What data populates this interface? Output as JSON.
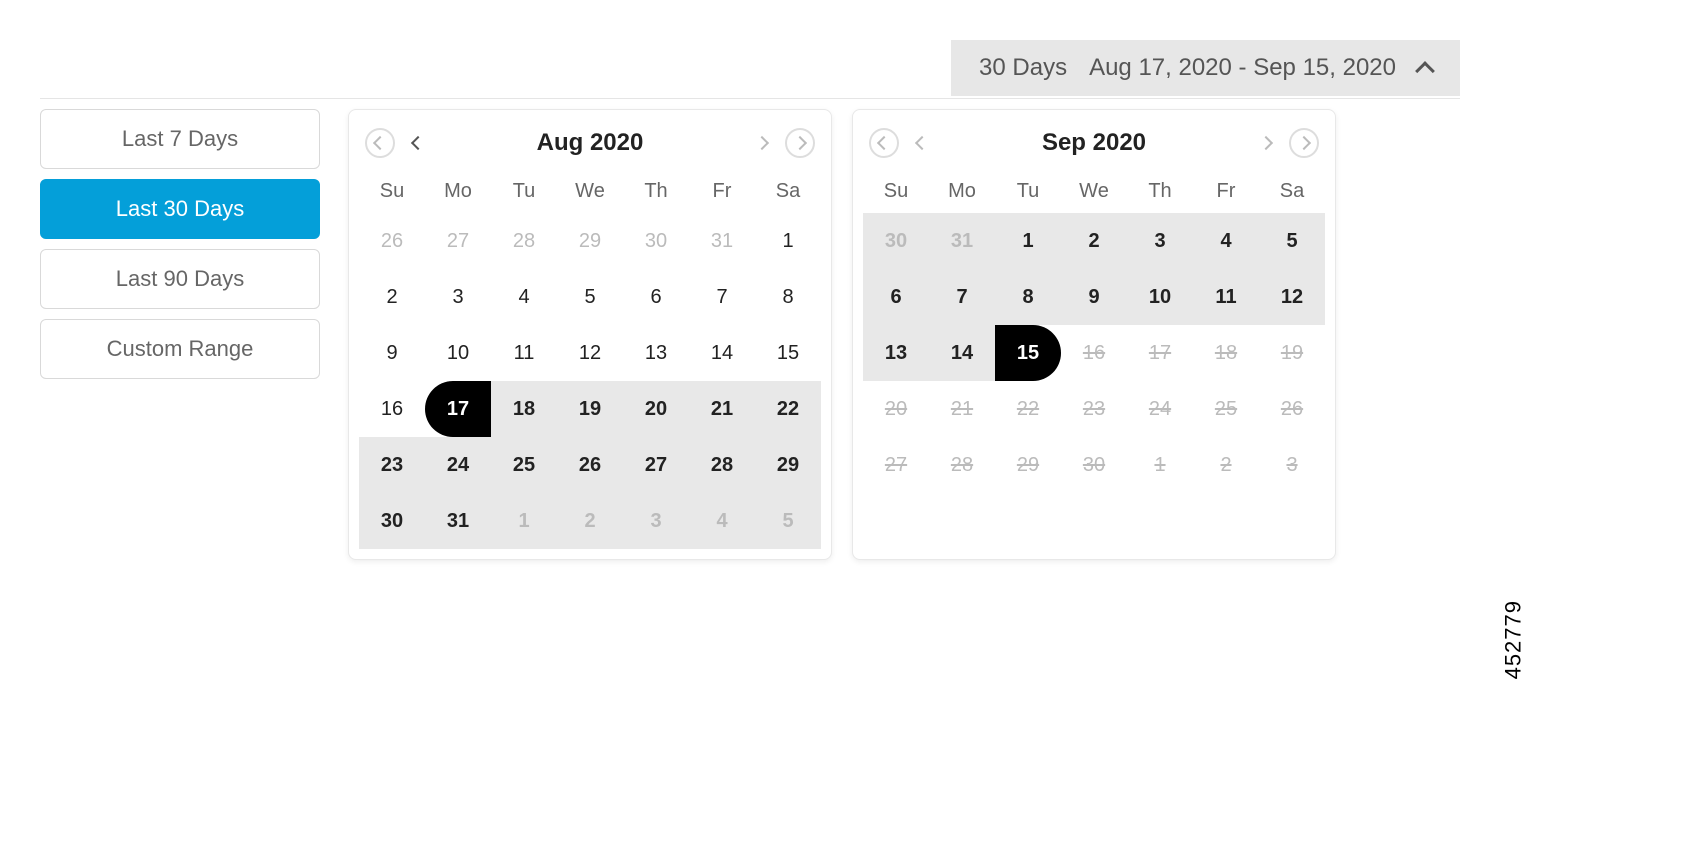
{
  "topbar": {
    "duration": "30 Days",
    "range_text": "Aug 17, 2020 - Sep 15, 2020"
  },
  "presets": [
    {
      "key": "last7",
      "label": "Last 7 Days",
      "active": false
    },
    {
      "key": "last30",
      "label": "Last 30 Days",
      "active": true
    },
    {
      "key": "last90",
      "label": "Last 90 Days",
      "active": false
    },
    {
      "key": "custom",
      "label": "Custom Range",
      "active": false
    }
  ],
  "dow": [
    "Su",
    "Mo",
    "Tu",
    "We",
    "Th",
    "Fr",
    "Sa"
  ],
  "calendars": [
    {
      "title": "Aug 2020",
      "nav_prev_enabled": true,
      "nav_next_enabled": false,
      "weeks": [
        [
          {
            "n": 26,
            "off": true
          },
          {
            "n": 27,
            "off": true
          },
          {
            "n": 28,
            "off": true
          },
          {
            "n": 29,
            "off": true
          },
          {
            "n": 30,
            "off": true
          },
          {
            "n": 31,
            "off": true
          },
          {
            "n": 1
          }
        ],
        [
          {
            "n": 2
          },
          {
            "n": 3
          },
          {
            "n": 4
          },
          {
            "n": 5
          },
          {
            "n": 6
          },
          {
            "n": 7
          },
          {
            "n": 8
          }
        ],
        [
          {
            "n": 9
          },
          {
            "n": 10
          },
          {
            "n": 11
          },
          {
            "n": 12
          },
          {
            "n": 13
          },
          {
            "n": 14
          },
          {
            "n": 15
          }
        ],
        [
          {
            "n": 16
          },
          {
            "n": 17,
            "start": true
          },
          {
            "n": 18,
            "in": true
          },
          {
            "n": 19,
            "in": true
          },
          {
            "n": 20,
            "in": true
          },
          {
            "n": 21,
            "in": true
          },
          {
            "n": 22,
            "in": true
          }
        ],
        [
          {
            "n": 23,
            "in": true
          },
          {
            "n": 24,
            "in": true
          },
          {
            "n": 25,
            "in": true
          },
          {
            "n": 26,
            "in": true
          },
          {
            "n": 27,
            "in": true
          },
          {
            "n": 28,
            "in": true
          },
          {
            "n": 29,
            "in": true
          }
        ],
        [
          {
            "n": 30,
            "in": true
          },
          {
            "n": 31,
            "in": true
          },
          {
            "n": 1,
            "off": true,
            "in": true
          },
          {
            "n": 2,
            "off": true,
            "in": true
          },
          {
            "n": 3,
            "off": true,
            "in": true
          },
          {
            "n": 4,
            "off": true,
            "in": true
          },
          {
            "n": 5,
            "off": true,
            "in": true
          }
        ]
      ]
    },
    {
      "title": "Sep 2020",
      "nav_prev_enabled": false,
      "nav_next_enabled": false,
      "weeks": [
        [
          {
            "n": 30,
            "off": true,
            "in": true
          },
          {
            "n": 31,
            "off": true,
            "in": true
          },
          {
            "n": 1,
            "in": true
          },
          {
            "n": 2,
            "in": true
          },
          {
            "n": 3,
            "in": true
          },
          {
            "n": 4,
            "in": true
          },
          {
            "n": 5,
            "in": true
          }
        ],
        [
          {
            "n": 6,
            "in": true
          },
          {
            "n": 7,
            "in": true
          },
          {
            "n": 8,
            "in": true
          },
          {
            "n": 9,
            "in": true
          },
          {
            "n": 10,
            "in": true
          },
          {
            "n": 11,
            "in": true
          },
          {
            "n": 12,
            "in": true
          }
        ],
        [
          {
            "n": 13,
            "in": true
          },
          {
            "n": 14,
            "in": true
          },
          {
            "n": 15,
            "end": true
          },
          {
            "n": 16,
            "dis": true
          },
          {
            "n": 17,
            "dis": true
          },
          {
            "n": 18,
            "dis": true
          },
          {
            "n": 19,
            "dis": true
          }
        ],
        [
          {
            "n": 20,
            "dis": true
          },
          {
            "n": 21,
            "dis": true
          },
          {
            "n": 22,
            "dis": true
          },
          {
            "n": 23,
            "dis": true
          },
          {
            "n": 24,
            "dis": true
          },
          {
            "n": 25,
            "dis": true
          },
          {
            "n": 26,
            "dis": true
          }
        ],
        [
          {
            "n": 27,
            "dis": true
          },
          {
            "n": 28,
            "dis": true
          },
          {
            "n": 29,
            "dis": true
          },
          {
            "n": 30,
            "dis": true
          },
          {
            "n": 1,
            "off": true,
            "dis": true
          },
          {
            "n": 2,
            "off": true,
            "dis": true
          },
          {
            "n": 3,
            "off": true,
            "dis": true
          }
        ]
      ]
    }
  ],
  "figure_id": "452779"
}
